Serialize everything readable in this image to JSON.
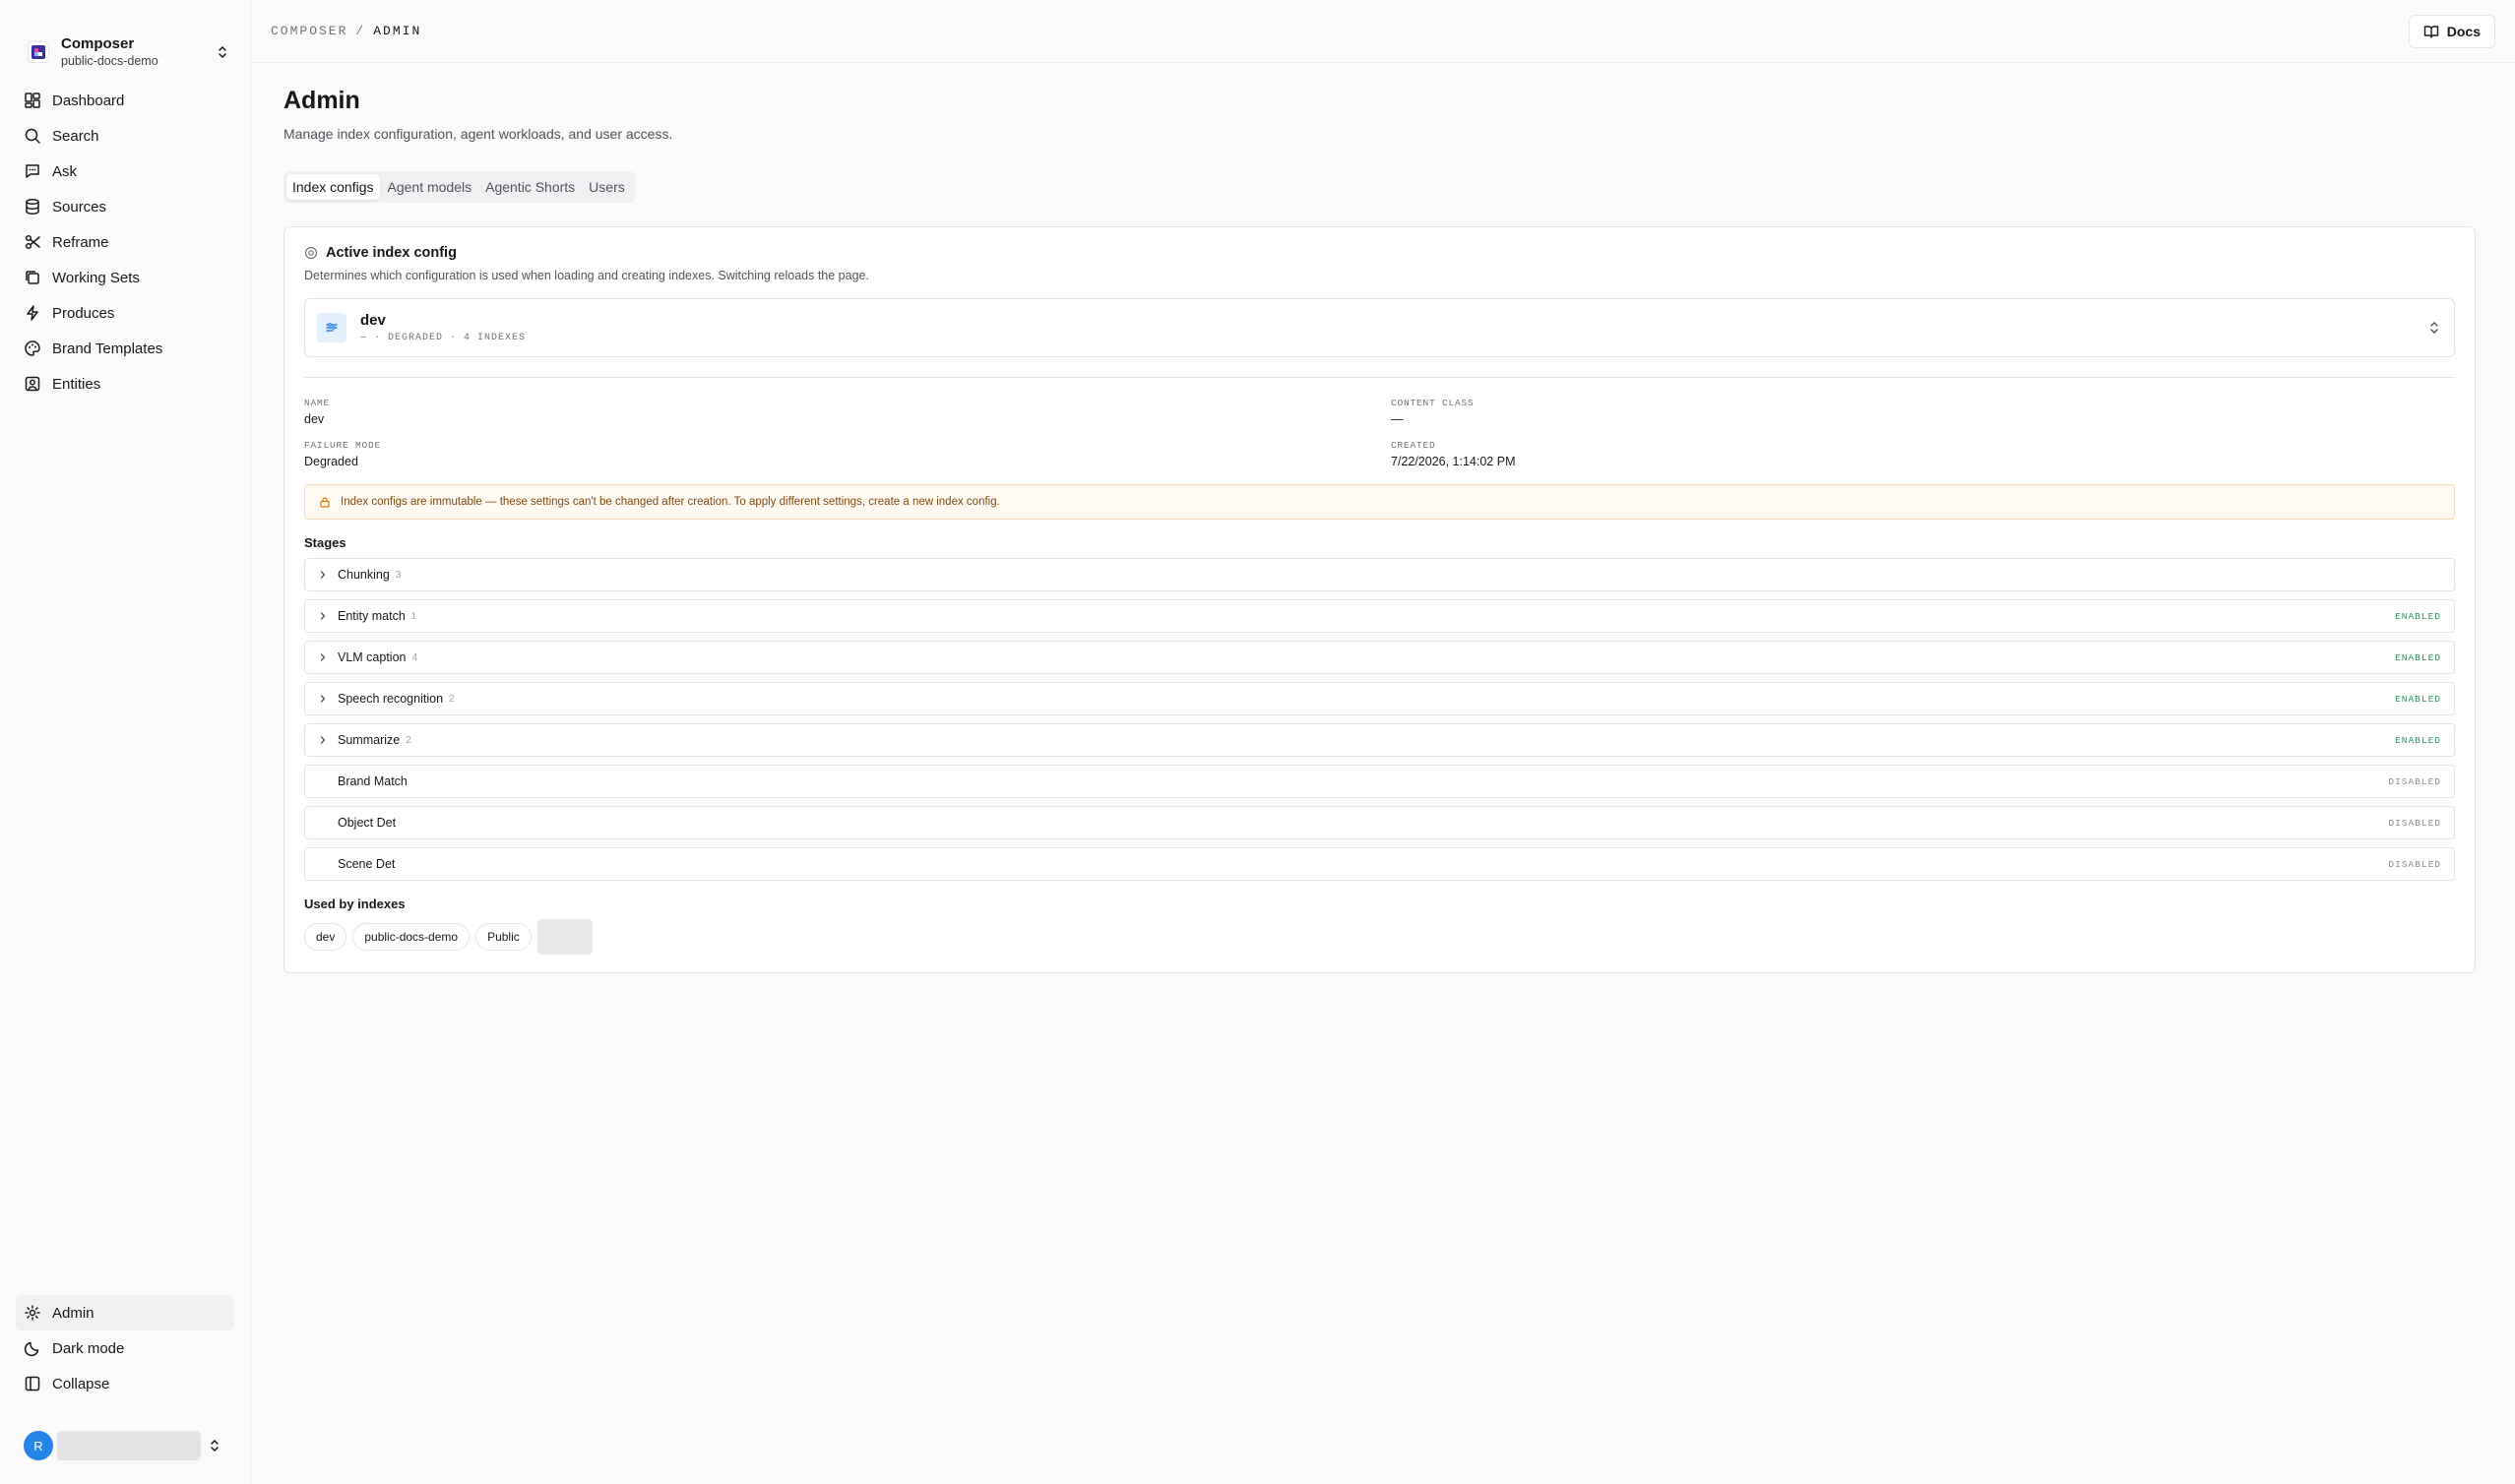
{
  "workspace": {
    "name": "Composer",
    "project": "public-docs-demo"
  },
  "nav": {
    "items": [
      {
        "label": "Dashboard",
        "icon": "dashboard-icon"
      },
      {
        "label": "Search",
        "icon": "search-icon"
      },
      {
        "label": "Ask",
        "icon": "chat-icon"
      },
      {
        "label": "Sources",
        "icon": "database-icon"
      },
      {
        "label": "Reframe",
        "icon": "scissors-icon"
      },
      {
        "label": "Working Sets",
        "icon": "copy-icon"
      },
      {
        "label": "Produces",
        "icon": "bolt-icon"
      },
      {
        "label": "Brand Templates",
        "icon": "palette-icon"
      },
      {
        "label": "Entities",
        "icon": "contact-icon"
      }
    ],
    "bottom": [
      {
        "label": "Admin",
        "icon": "gear-icon",
        "active": true
      },
      {
        "label": "Dark mode",
        "icon": "moon-icon"
      },
      {
        "label": "Collapse",
        "icon": "panel-icon"
      }
    ]
  },
  "user": {
    "initial": "R"
  },
  "breadcrumb": {
    "root": "COMPOSER",
    "sep": "/",
    "current": "ADMIN"
  },
  "docs_label": "Docs",
  "page": {
    "title": "Admin",
    "subtitle": "Manage index configuration, agent workloads, and user access."
  },
  "tabs": [
    "Index configs",
    "Agent models",
    "Agentic Shorts",
    "Users"
  ],
  "active_tab": "Index configs",
  "card": {
    "title": "Active index config",
    "desc": "Determines which configuration is used when loading and creating indexes. Switching reloads the page.",
    "select": {
      "name": "dev",
      "meta": "— · DEGRADED · 4 INDEXES"
    },
    "fields": {
      "name_label": "NAME",
      "name": "dev",
      "content_class_label": "CONTENT CLASS",
      "content_class": "—",
      "failure_mode_label": "FAILURE MODE",
      "failure_mode": "Degraded",
      "created_label": "CREATED",
      "created": "7/22/2026, 1:14:02 PM"
    },
    "warning": "Index configs are immutable — these settings can't be changed after creation. To apply different settings, create a new index config.",
    "stages_title": "Stages",
    "stages": [
      {
        "name": "Chunking",
        "count": "3",
        "status": "",
        "expandable": true
      },
      {
        "name": "Entity match",
        "count": "1",
        "status": "ENABLED",
        "expandable": true
      },
      {
        "name": "VLM caption",
        "count": "4",
        "status": "ENABLED",
        "expandable": true
      },
      {
        "name": "Speech recognition",
        "count": "2",
        "status": "ENABLED",
        "expandable": true
      },
      {
        "name": "Summarize",
        "count": "2",
        "status": "ENABLED",
        "expandable": true
      },
      {
        "name": "Brand Match",
        "count": "",
        "status": "DISABLED",
        "expandable": false
      },
      {
        "name": "Object Det",
        "count": "",
        "status": "DISABLED",
        "expandable": false
      },
      {
        "name": "Scene Det",
        "count": "",
        "status": "DISABLED",
        "expandable": false
      }
    ],
    "used_title": "Used by indexes",
    "used_by": [
      "dev",
      "public-docs-demo",
      "Public"
    ]
  },
  "colors": {
    "accent": "#2484e8",
    "enabled": "#2f8f5f",
    "warning_bg": "#fffaf1"
  }
}
